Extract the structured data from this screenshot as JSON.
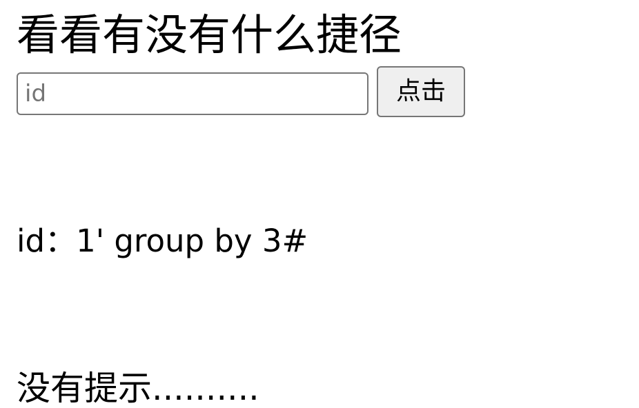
{
  "page": {
    "title": "看看有没有什么捷径"
  },
  "form": {
    "input": {
      "value": "",
      "placeholder": "id"
    },
    "button_label": "点击"
  },
  "result": {
    "line": "id：1' group by 3#"
  },
  "hint": {
    "text": "没有提示.........."
  },
  "colors": {
    "background": "#ffffff",
    "text": "#000000",
    "input_border": "#767676",
    "button_background": "#efefef",
    "placeholder": "#757575"
  }
}
